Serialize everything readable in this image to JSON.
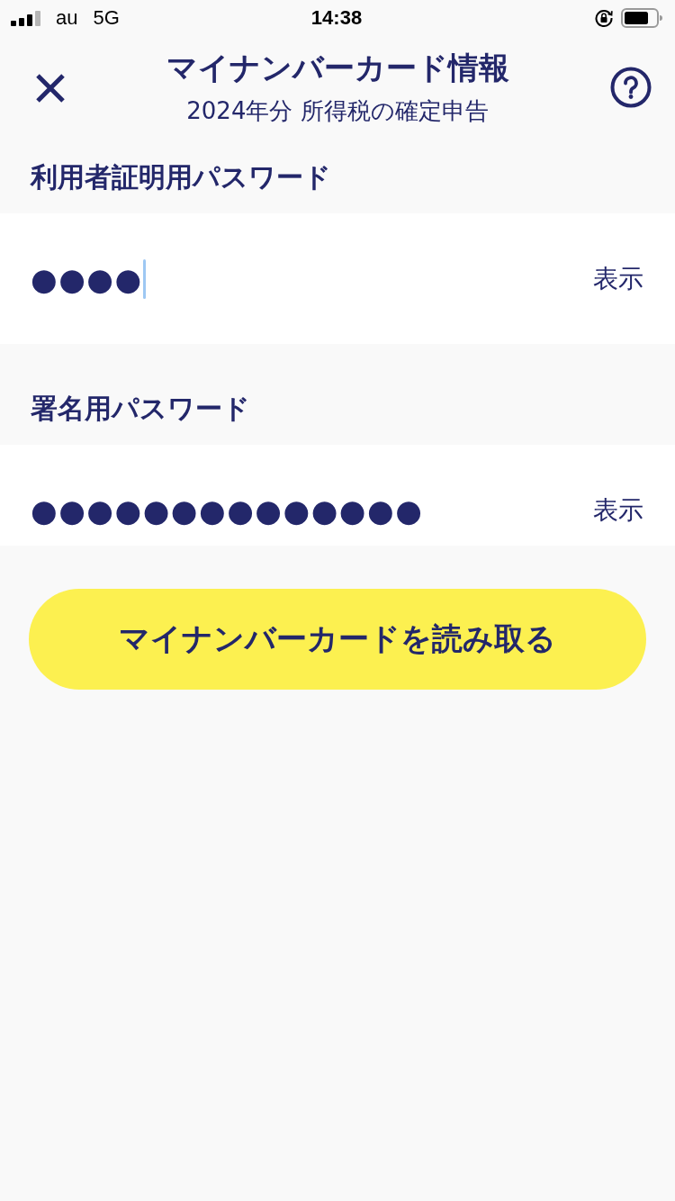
{
  "status_bar": {
    "carrier": "au",
    "network": "5G",
    "time": "14:38"
  },
  "header": {
    "title": "マイナンバーカード情報",
    "subtitle": "2024年分 所得税の確定申告"
  },
  "fields": [
    {
      "label": "利用者証明用パスワード",
      "value": "●●●●",
      "toggle": "表示",
      "focused": true
    },
    {
      "label": "署名用パスワード",
      "value": "●●●●●●●●●●●●●●",
      "toggle": "表示",
      "focused": false
    }
  ],
  "button": {
    "label": "マイナンバーカードを読み取る"
  }
}
